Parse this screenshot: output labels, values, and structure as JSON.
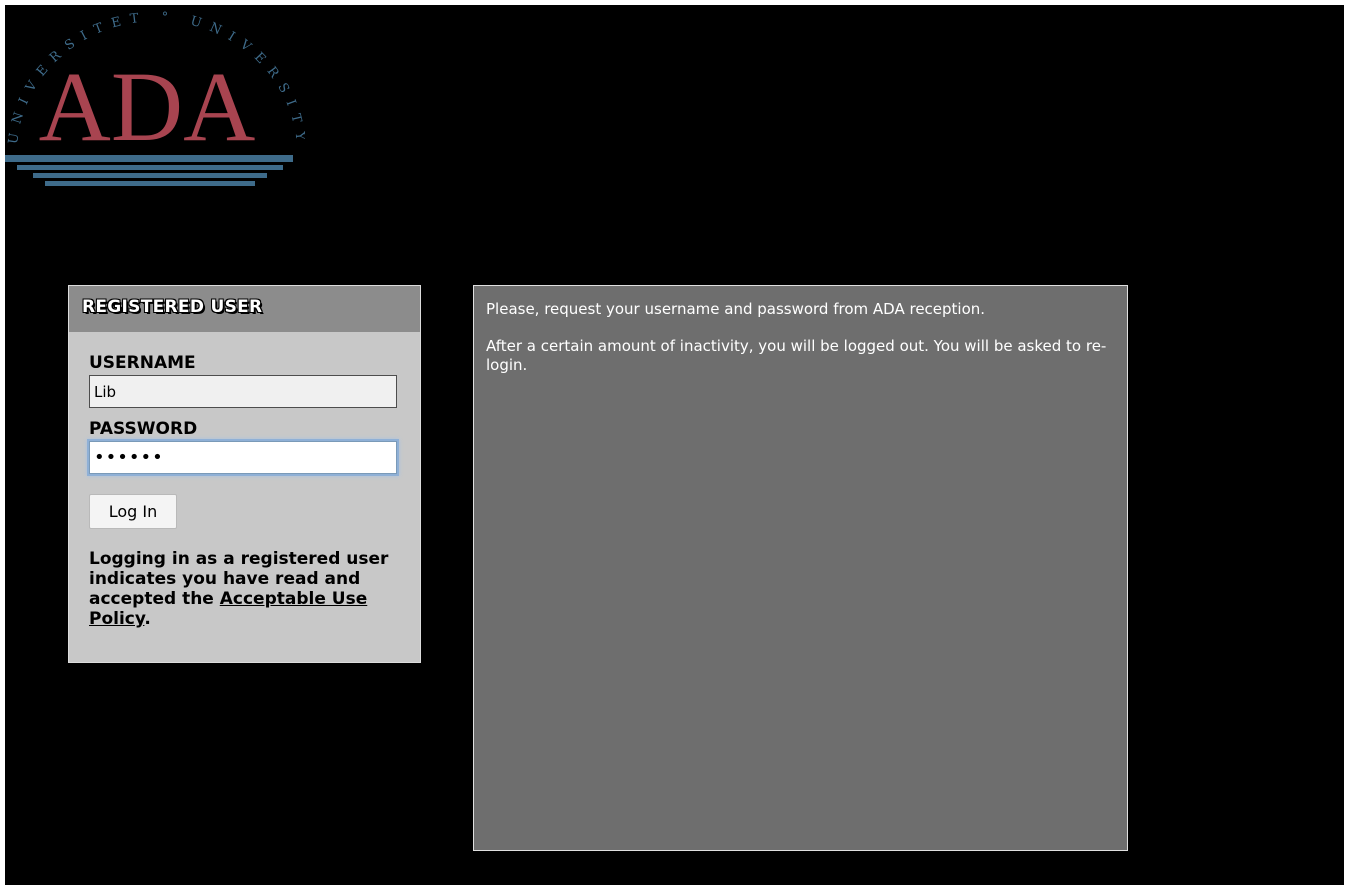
{
  "logo": {
    "arc_text": "UNIVERSITET ° UNIVERSITY",
    "wordmark": "ADA",
    "colors": {
      "wordmark": "#a84450",
      "arc": "#3e6b8a",
      "lines": "#3e6b8a"
    }
  },
  "login": {
    "header": "REGISTERED USER",
    "username_label": "USERNAME",
    "username_value": "Lib",
    "password_label": "PASSWORD",
    "password_value": "secret",
    "button_label": "Log In",
    "policy_prefix": "Logging in as a registered user indicates you have read and accepted the",
    "policy_link": "Acceptable Use Policy",
    "policy_suffix": "."
  },
  "info": {
    "paragraph_1": "Please, request your username and password from ADA reception.",
    "paragraph_2": "After a certain amount of inactivity, you will be logged out. You will be asked to re-login."
  },
  "colors": {
    "background": "#000000",
    "login_panel": "#c8c8c8",
    "login_header": "#8c8c8c",
    "info_panel": "#6e6e6e"
  }
}
